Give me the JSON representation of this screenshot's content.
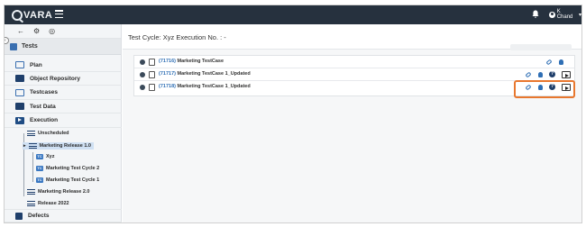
{
  "app": {
    "logo_text": "VARA",
    "logo_letter": "Q"
  },
  "topbar": {
    "user_name": "K Chand",
    "caret": "▾"
  },
  "sidebar": {
    "tools": [
      "←",
      "⚙",
      "◎"
    ],
    "title": "Tests",
    "items": [
      {
        "label": "Plan"
      },
      {
        "label": "Object Repository"
      },
      {
        "label": "Testcases"
      },
      {
        "label": "Test Data"
      },
      {
        "label": "Execution"
      },
      {
        "label": "Defects"
      }
    ],
    "tree": {
      "unscheduled": "Unscheduled",
      "release_1": "Marketing Release 1.0",
      "cycle_xyz": "Xyz",
      "cycle_2": "Marketing Test Cycle 2",
      "cycle_1": "Marketing Test Cycle 1",
      "release_2": "Marketing Release 2.0",
      "release_2022": "Release 2022",
      "cycle_icon_text": "TC"
    }
  },
  "main": {
    "title": "Test Cycle: Xyz Execution No. : -",
    "cases": [
      {
        "id": "(71716)",
        "name": "Marketing TestCase"
      },
      {
        "id": "(71717)",
        "name": "Marketing TestCase 1_Updated"
      },
      {
        "id": "(71718)",
        "name": "Marketing TestCase 1_Updated"
      }
    ],
    "help_glyph": "?"
  },
  "colors": {
    "topbar": "#26313e",
    "accent": "#2f6fb5",
    "highlight": "#e8772e",
    "selected": "#cfe0f3"
  }
}
